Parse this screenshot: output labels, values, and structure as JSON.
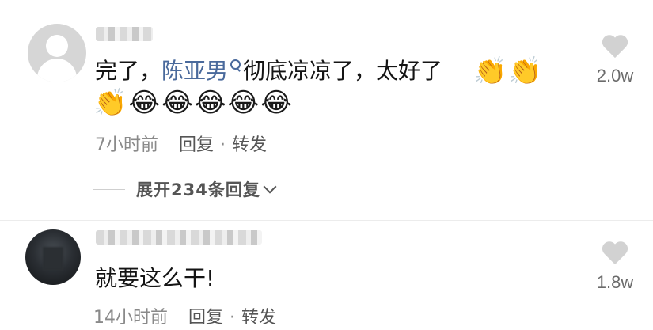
{
  "comments": [
    {
      "text_before": "完了，",
      "mention": "陈亚男",
      "text_after": "彻底凉凉了，太好了",
      "emojis_line1": [
        "👏",
        "👏"
      ],
      "emojis_line2": [
        "👏",
        "😂",
        "😂",
        "😂",
        "😂",
        "😂"
      ],
      "time": "7小时前",
      "reply": "回复",
      "dot": "·",
      "forward": "转发",
      "expand": "展开234条回复",
      "likes": "2.0w"
    },
    {
      "text": "就要这么干!",
      "time": "14小时前",
      "reply": "回复",
      "dot": "·",
      "forward": "转发",
      "likes": "1.8w"
    }
  ],
  "colors": {
    "mention": "#4a6a9c",
    "meta": "#8a8a8a",
    "heart": "#d2d2d2"
  },
  "icons": {
    "search": "search-icon",
    "like": "heart-icon",
    "expand": "chevron-down-icon"
  }
}
